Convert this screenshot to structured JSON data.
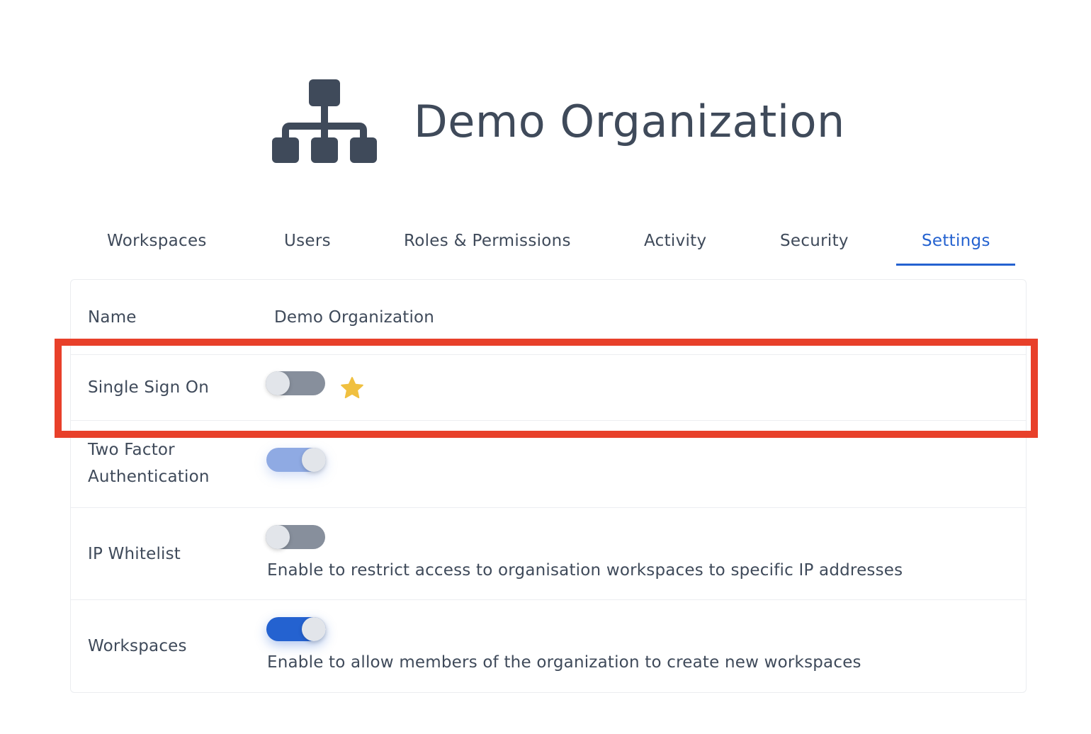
{
  "header": {
    "icon": "organization-icon",
    "title": "Demo Organization"
  },
  "tabs": [
    {
      "label": "Workspaces",
      "active": false
    },
    {
      "label": "Users",
      "active": false
    },
    {
      "label": "Roles & Permissions",
      "active": false
    },
    {
      "label": "Activity",
      "active": false
    },
    {
      "label": "Security",
      "active": false
    },
    {
      "label": "Settings",
      "active": true
    }
  ],
  "settings": {
    "name": {
      "label": "Name",
      "value": "Demo Organization"
    },
    "sso": {
      "label": "Single Sign On",
      "toggle": "off",
      "badge_icon": "star-icon"
    },
    "two_factor": {
      "label_line1": "Two Factor",
      "label_line2": "Authentication",
      "toggle": "on"
    },
    "ip_whitelist": {
      "label": "IP Whitelist",
      "toggle": "off",
      "description": "Enable to restrict access to organisation workspaces to specific IP addresses"
    },
    "workspaces": {
      "label": "Workspaces",
      "toggle": "on",
      "description": "Enable to allow members of the organization to create new workspaces"
    }
  },
  "colors": {
    "accent": "#2462d0",
    "text": "#3f4a5a",
    "highlight": "#e8402a",
    "star": "#f0c040",
    "toggle_off": "#878f9c"
  }
}
